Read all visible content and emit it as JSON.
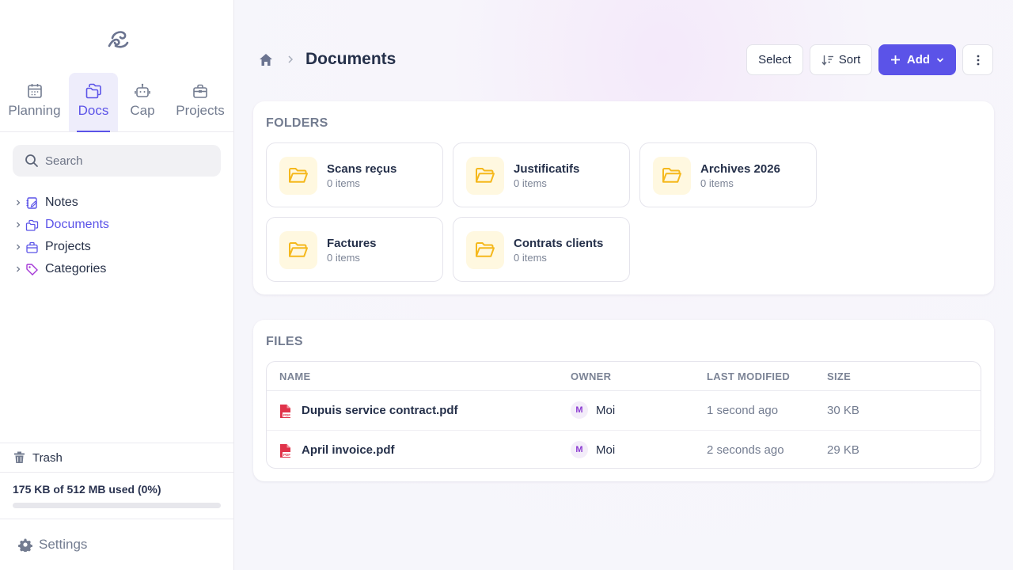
{
  "sidebar": {
    "tabs": [
      {
        "label": "Planning",
        "icon": "calendar-icon"
      },
      {
        "label": "Docs",
        "icon": "docs-icon",
        "active": true
      },
      {
        "label": "Cap",
        "icon": "robot-icon"
      },
      {
        "label": "Projects",
        "icon": "briefcase-icon"
      }
    ],
    "search_placeholder": "Search",
    "tree": [
      {
        "label": "Notes",
        "icon": "notebook-icon"
      },
      {
        "label": "Documents",
        "icon": "docs-icon",
        "active": true
      },
      {
        "label": "Projects",
        "icon": "briefcase-icon"
      },
      {
        "label": "Categories",
        "icon": "tag-icon"
      }
    ],
    "trash_label": "Trash",
    "storage_text": "175 KB of 512 MB used (0%)",
    "storage_percent": 0,
    "settings_label": "Settings"
  },
  "header": {
    "title": "Documents",
    "select_label": "Select",
    "sort_label": "Sort",
    "add_label": "Add"
  },
  "folders": {
    "title": "FOLDERS",
    "items": [
      {
        "name": "Scans reçus",
        "count": "0 items"
      },
      {
        "name": "Justificatifs",
        "count": "0 items"
      },
      {
        "name": "Archives 2026",
        "count": "0 items"
      },
      {
        "name": "Factures",
        "count": "0 items"
      },
      {
        "name": "Contrats clients",
        "count": "0 items"
      }
    ]
  },
  "files": {
    "title": "FILES",
    "columns": {
      "name": "NAME",
      "owner": "OWNER",
      "modified": "LAST MODIFIED",
      "size": "SIZE"
    },
    "rows": [
      {
        "name": "Dupuis service contract.pdf",
        "avatar": "M",
        "owner": "Moi",
        "modified": "1 second ago",
        "size": "30 KB"
      },
      {
        "name": "April invoice.pdf",
        "avatar": "M",
        "owner": "Moi",
        "modified": "2 seconds ago",
        "size": "29 KB"
      }
    ]
  },
  "colors": {
    "accent": "#5b53e8",
    "folder": "#f5b81c",
    "pdf": "#e0334a"
  }
}
